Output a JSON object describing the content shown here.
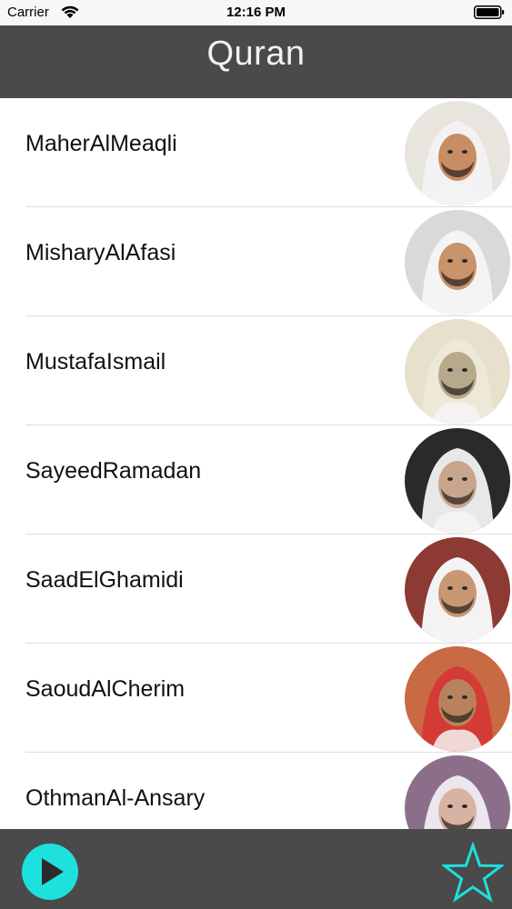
{
  "status_bar": {
    "carrier": "Carrier",
    "time": "12:16 PM",
    "wifi_icon": "wifi-icon",
    "battery_icon": "battery-icon"
  },
  "header": {
    "title": "Quran"
  },
  "reciters": [
    {
      "name": "MaherAlMeaqli",
      "avatar_icon": "reciter-photo",
      "skin": "#c98d63",
      "head": "#f2f2f2",
      "bg": "#e8e4de"
    },
    {
      "name": "MisharyAlAfasi",
      "avatar_icon": "reciter-photo",
      "skin": "#c9936b",
      "head": "#f4f4f4",
      "bg": "#d9d9d9"
    },
    {
      "name": "MustafaIsmail",
      "avatar_icon": "reciter-photo",
      "skin": "#b7aa8c",
      "head": "#ede8d8",
      "bg": "#e6e0cc"
    },
    {
      "name": "SayeedRamadan",
      "avatar_icon": "reciter-photo",
      "skin": "#c8a58c",
      "head": "#e8e8e8",
      "bg": "#2a2a2a"
    },
    {
      "name": "SaadElGhamidi",
      "avatar_icon": "reciter-photo",
      "skin": "#c99774",
      "head": "#f3f3f3",
      "bg": "#8e3a34"
    },
    {
      "name": "SaoudAlCherim",
      "avatar_icon": "reciter-photo",
      "skin": "#b9825d",
      "head": "#d43b34",
      "bg": "#c86a44"
    },
    {
      "name": "OthmanAl-Ansary",
      "avatar_icon": "reciter-photo",
      "skin": "#d8b3a4",
      "head": "#ece6ee",
      "bg": "#8b6f8a"
    }
  ],
  "bottom_bar": {
    "play_icon": "play-icon",
    "favorite_icon": "star-icon",
    "accent": "#1ee0dd"
  }
}
